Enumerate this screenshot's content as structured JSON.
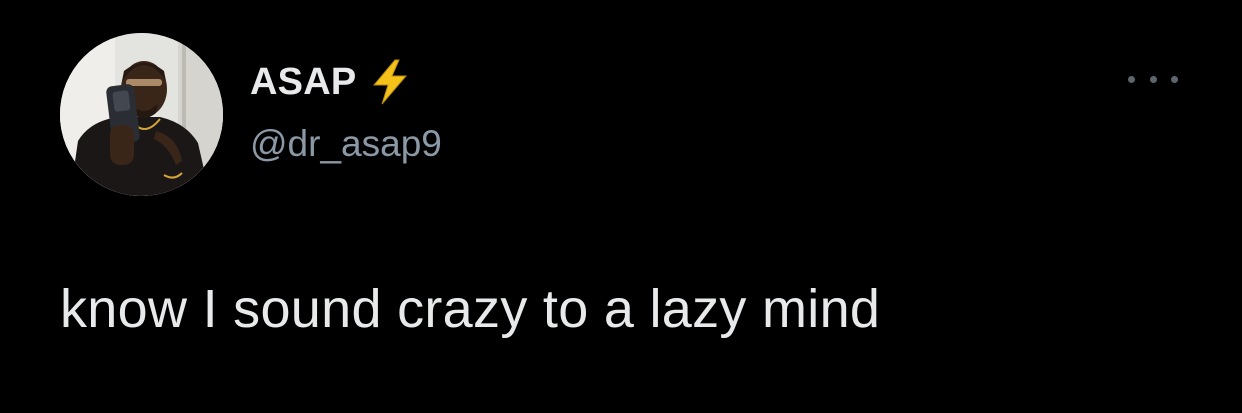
{
  "tweet": {
    "author": {
      "display_name": "ASAP",
      "handle": "@dr_asap9",
      "badge_icon": "lightning-bolt-icon",
      "avatar_icon": "profile-photo"
    },
    "text": "know I sound crazy to a lazy mind",
    "menu_icon": "more-options-icon"
  },
  "colors": {
    "background": "#000000",
    "primary_text": "#e7e9ea",
    "secondary_text": "#8b98a5",
    "bolt_yellow": "#f5c21a",
    "menu_dots": "#5b6670"
  }
}
